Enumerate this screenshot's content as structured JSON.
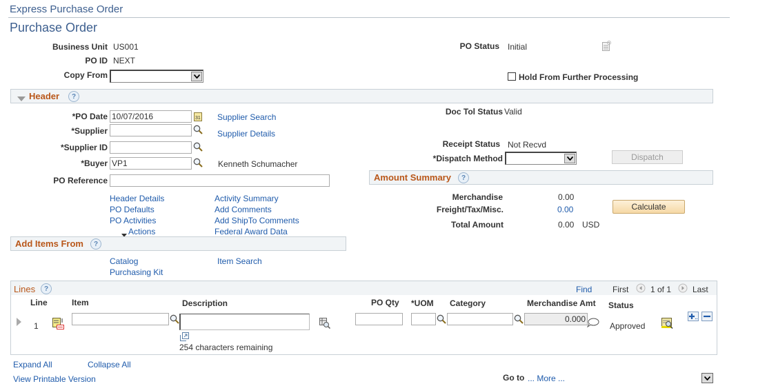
{
  "breadcrumb": "Express Purchase Order",
  "page_title": "Purchase Order",
  "top": {
    "business_unit_label": "Business Unit",
    "business_unit": "US001",
    "po_id_label": "PO ID",
    "po_id": "NEXT",
    "copy_from_label": "Copy From",
    "copy_from_value": "",
    "po_status_label": "PO Status",
    "po_status": "Initial",
    "hold_label": "Hold From Further Processing",
    "hold_checked": false
  },
  "header": {
    "title": "Header",
    "help": "?",
    "po_date_label": "*PO Date",
    "po_date": "10/07/2016",
    "supplier_label": "*Supplier",
    "supplier": "",
    "supplier_id_label": "*Supplier ID",
    "supplier_id": "",
    "buyer_label": "*Buyer",
    "buyer": "VP1",
    "buyer_name": "Kenneth Schumacher",
    "po_reference_label": "PO Reference",
    "po_reference": "",
    "supplier_search": "Supplier Search",
    "supplier_details": "Supplier Details",
    "doc_tol_label": "Doc Tol Status",
    "doc_tol": "Valid",
    "receipt_status_label": "Receipt Status",
    "receipt_status": "Not Recvd",
    "dispatch_method_label": "*Dispatch Method",
    "dispatch_method": "",
    "dispatch_button": "Dispatch",
    "links_left": [
      "Header Details",
      "PO Defaults",
      "PO Activities",
      "Actions"
    ],
    "links_right": [
      "Activity Summary",
      "Add Comments",
      "Add ShipTo Comments",
      "Federal Award Data"
    ]
  },
  "amount_summary": {
    "title": "Amount Summary",
    "merchandise_label": "Merchandise",
    "merchandise": "0.00",
    "freight_label": "Freight/Tax/Misc.",
    "freight": "0.00",
    "total_label": "Total Amount",
    "total": "0.00",
    "currency": "USD",
    "calculate_button": "Calculate"
  },
  "add_items": {
    "title": "Add Items From",
    "catalog": "Catalog",
    "item_search": "Item Search",
    "purchasing_kit": "Purchasing Kit"
  },
  "lines": {
    "title": "Lines",
    "find": "Find",
    "first": "First",
    "pager": "1 of 1",
    "last": "Last",
    "columns": [
      "Line",
      "Item",
      "Description",
      "PO Qty",
      "*UOM",
      "Category",
      "Merchandise Amt",
      "Status"
    ],
    "rows": [
      {
        "line": "1",
        "item": "",
        "description": "",
        "chars_remaining": "254 characters remaining",
        "po_qty": "",
        "uom": "",
        "category": "",
        "merchandise_amt": "0.000",
        "status": "Approved"
      }
    ]
  },
  "footer": {
    "expand_all": "Expand All",
    "collapse_all": "Collapse All",
    "printable": "View Printable Version",
    "goto_label": "Go to",
    "goto_value": "... More ..."
  }
}
